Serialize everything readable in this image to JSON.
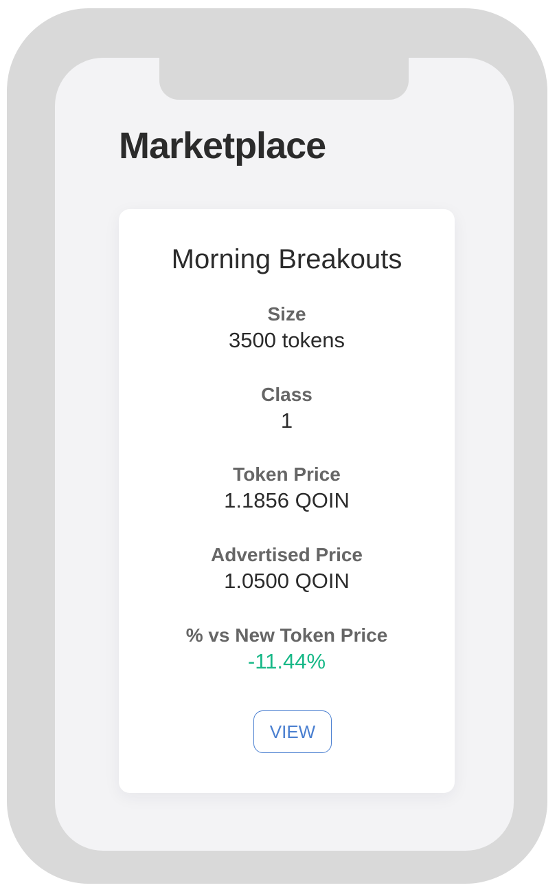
{
  "page": {
    "title": "Marketplace"
  },
  "card": {
    "title": "Morning Breakouts",
    "fields": [
      {
        "label": "Size",
        "value": "3500 tokens"
      },
      {
        "label": "Class",
        "value": "1"
      },
      {
        "label": "Token Price",
        "value": "1.1856 QOIN"
      },
      {
        "label": "Advertised Price",
        "value": "1.0500 QOIN"
      },
      {
        "label": "% vs New Token Price",
        "value": "-11.44%"
      }
    ],
    "view_label": "VIEW"
  },
  "colors": {
    "positive_value": "#17b887",
    "button_accent": "#4a7fd0",
    "frame": "#d9d9d9",
    "screen": "#f3f3f5"
  }
}
